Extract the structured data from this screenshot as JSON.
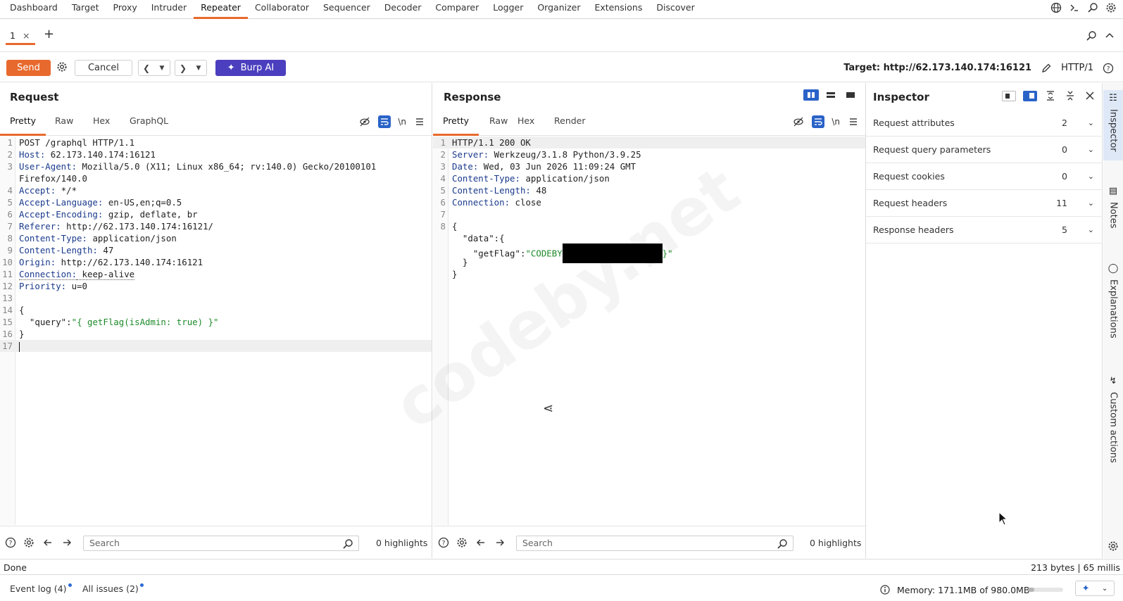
{
  "topnav": {
    "items": [
      "Dashboard",
      "Target",
      "Proxy",
      "Intruder",
      "Repeater",
      "Collaborator",
      "Sequencer",
      "Decoder",
      "Comparer",
      "Logger",
      "Organizer",
      "Extensions",
      "Discover"
    ],
    "active": "Repeater",
    "icons": [
      "globe-icon",
      "terminal-icon",
      "search-icon",
      "gear-icon"
    ]
  },
  "tabstrip": {
    "tab_label": "1",
    "close_glyph": "×",
    "add_glyph": "+"
  },
  "toolbar": {
    "send_label": "Send",
    "cancel_label": "Cancel",
    "burp_ai_label": "Burp AI",
    "target_label": "Target: http://62.173.140.174:16121",
    "protocol_label": "HTTP/1"
  },
  "request": {
    "title": "Request",
    "tabs": [
      "Pretty",
      "Raw",
      "Hex",
      "GraphQL"
    ],
    "active_tab": "Pretty",
    "lines": [
      {
        "n": "1",
        "text": "POST /graphql HTTP/1.1"
      },
      {
        "n": "2",
        "key": "Host:",
        "value": " 62.173.140.174:16121"
      },
      {
        "n": "3",
        "key": "User-Agent:",
        "value": " Mozilla/5.0 (X11; Linux x86_64; rv:140.0) Gecko/20100101"
      },
      {
        "n": "",
        "text": "Firefox/140.0"
      },
      {
        "n": "4",
        "key": "Accept:",
        "value": " */*"
      },
      {
        "n": "5",
        "key": "Accept-Language:",
        "value": " en-US,en;q=0.5"
      },
      {
        "n": "6",
        "key": "Accept-Encoding:",
        "value": " gzip, deflate, br"
      },
      {
        "n": "7",
        "key": "Referer:",
        "value": " http://62.173.140.174:16121/"
      },
      {
        "n": "8",
        "key": "Content-Type:",
        "value": " application/json"
      },
      {
        "n": "9",
        "key": "Content-Length:",
        "value": " 47"
      },
      {
        "n": "10",
        "key": "Origin:",
        "value": " http://62.173.140.174:16121"
      },
      {
        "n": "11",
        "key": "Connection:",
        "value": " keep-alive"
      },
      {
        "n": "12",
        "key": "Priority:",
        "value": " u=0"
      },
      {
        "n": "13",
        "text": ""
      },
      {
        "n": "14",
        "text": "{"
      },
      {
        "n": "15",
        "key": "  \"query\":",
        "str": "\"{ getFlag(isAdmin: true) }\""
      },
      {
        "n": "16",
        "text": "}"
      },
      {
        "n": "17",
        "text": ""
      }
    ],
    "search_placeholder": "Search",
    "highlights": "0 highlights"
  },
  "response": {
    "title": "Response",
    "tabs": [
      "Pretty",
      "Raw",
      "Hex",
      "Render"
    ],
    "active_tab": "Pretty",
    "lines": [
      {
        "n": "1",
        "text": "HTTP/1.1 200 OK"
      },
      {
        "n": "2",
        "key": "Server:",
        "value": " Werkzeug/3.1.8 Python/3.9.25"
      },
      {
        "n": "3",
        "key": "Date:",
        "value": " Wed, 03 Jun 2026 11:09:24 GMT"
      },
      {
        "n": "4",
        "key": "Content-Type:",
        "value": " application/json"
      },
      {
        "n": "5",
        "key": "Content-Length:",
        "value": " 48"
      },
      {
        "n": "6",
        "key": "Connection:",
        "value": " close"
      },
      {
        "n": "7",
        "text": ""
      },
      {
        "n": "8",
        "text": "{"
      },
      {
        "n": "",
        "text": "  \"data\":{"
      },
      {
        "n": "",
        "text": "    \"getFlag\":",
        "flag_prefix": "\"CODEBY",
        "flag_suffix": "}\""
      },
      {
        "n": "",
        "text": "  }"
      },
      {
        "n": "",
        "text": "}"
      }
    ],
    "search_placeholder": "Search",
    "highlights": "0 highlights"
  },
  "inspector": {
    "title": "Inspector",
    "rows": [
      {
        "label": "Request attributes",
        "count": "2"
      },
      {
        "label": "Request query parameters",
        "count": "0"
      },
      {
        "label": "Request cookies",
        "count": "0"
      },
      {
        "label": "Request headers",
        "count": "11"
      },
      {
        "label": "Response headers",
        "count": "5"
      }
    ]
  },
  "sidetabs": [
    "Inspector",
    "Notes",
    "Explanations",
    "Custom actions"
  ],
  "status": {
    "left": "Done",
    "right": "213 bytes | 65 millis"
  },
  "bottombar": {
    "event_log": "Event log (4)",
    "all_issues": "All issues (2)",
    "memory": "Memory: 171.1MB of 980.0MB",
    "memory_fraction": 0.17
  },
  "watermark": "codeby.net",
  "colors": {
    "accent": "#e8692d",
    "burp_ai": "#4b3fbf",
    "header_key": "#1a3a8c",
    "string": "#1d8a2a"
  }
}
